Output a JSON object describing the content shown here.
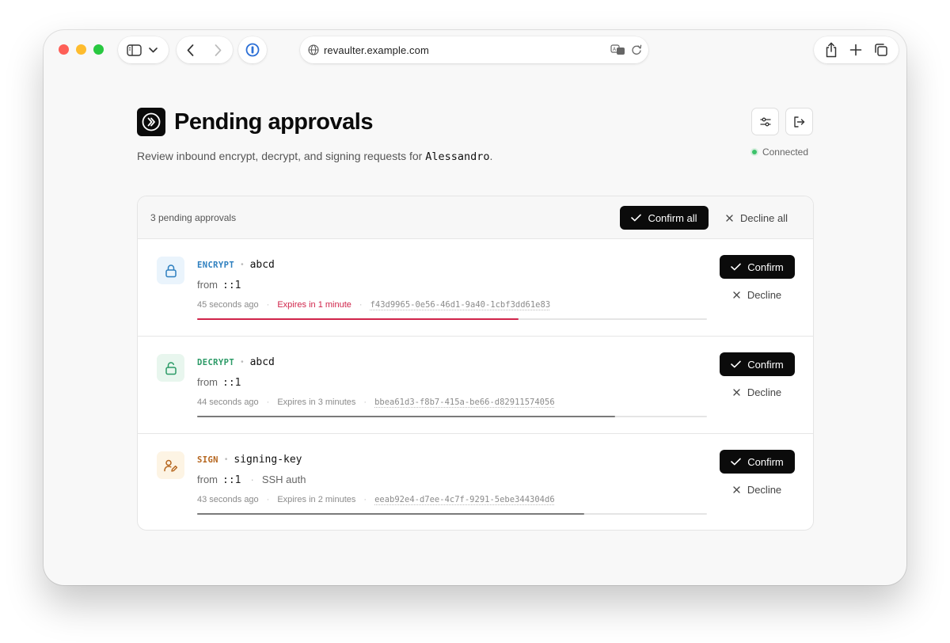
{
  "browser": {
    "url": "revaulter.example.com"
  },
  "page": {
    "title": "Pending approvals",
    "subtitle_prefix": "Review inbound encrypt, decrypt, and signing requests for ",
    "subtitle_user": "Alessandro",
    "subtitle_suffix": ".",
    "connection_status": "Connected",
    "accent_colors": {
      "encrypt": "#2d7fbf",
      "decrypt": "#2b9a66",
      "sign": "#b5651d",
      "expiring": "#d0244a",
      "connected": "#3cc26a"
    }
  },
  "approvals": {
    "count_label": "3 pending approvals",
    "confirm_all_label": "Confirm all",
    "decline_all_label": "Decline all",
    "items": [
      {
        "op": "ENCRYPT",
        "icon": "lock-icon",
        "key": "abcd",
        "from_label": "from",
        "from": "::1",
        "extra": "",
        "age": "45 seconds ago",
        "expires": "Expires in 1 minute",
        "request_id": "f43d9965-0e56-46d1-9a40-1cbf3dd61e83",
        "remaining_fraction": 0.63,
        "confirm_label": "Confirm",
        "decline_label": "Decline"
      },
      {
        "op": "DECRYPT",
        "icon": "unlock-icon",
        "key": "abcd",
        "from_label": "from",
        "from": "::1",
        "extra": "",
        "age": "44 seconds ago",
        "expires": "Expires in 3 minutes",
        "request_id": "bbea61d3-f8b7-415a-be66-d82911574056",
        "remaining_fraction": 0.82,
        "confirm_label": "Confirm",
        "decline_label": "Decline"
      },
      {
        "op": "SIGN",
        "icon": "user-sign-icon",
        "key": "signing-key",
        "from_label": "from",
        "from": "::1",
        "extra": "SSH auth",
        "age": "43 seconds ago",
        "expires": "Expires in 2 minutes",
        "request_id": "eeab92e4-d7ee-4c7f-9291-5ebe344304d6",
        "remaining_fraction": 0.76,
        "confirm_label": "Confirm",
        "decline_label": "Decline"
      }
    ]
  }
}
